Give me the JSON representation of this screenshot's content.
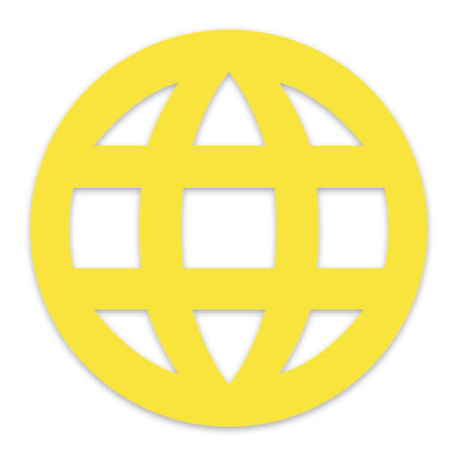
{
  "icon": {
    "semantic": "globe-icon",
    "colors": {
      "fill": "#f9e43c",
      "fill_dark": "#e2c90e",
      "shadow": "#6b5a00",
      "background": "#ffffff"
    }
  }
}
